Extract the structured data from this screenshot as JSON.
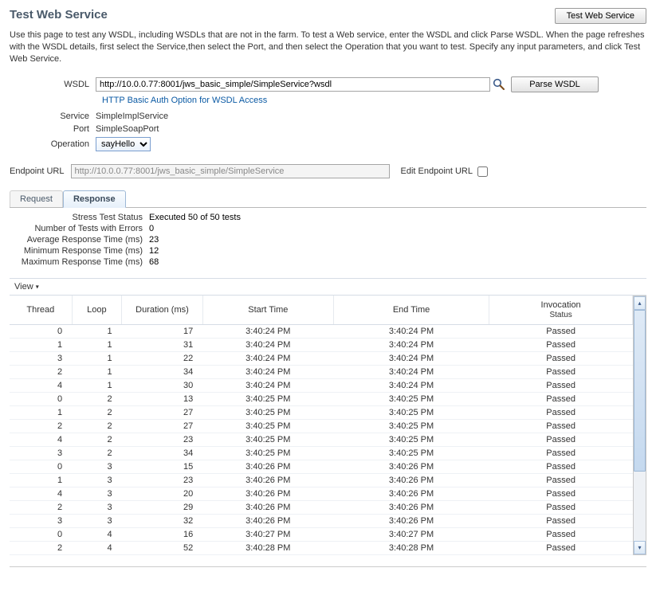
{
  "header": {
    "title": "Test Web Service",
    "top_button": "Test Web Service"
  },
  "intro": "Use this page to test any WSDL, including WSDLs that are not in the farm. To test a Web service, enter the WSDL and click Parse WSDL. When the page refreshes with the WSDL details, first select the Service,then select the Port, and then select the Operation that you want to test. Specify any input parameters, and click Test Web Service.",
  "form": {
    "wsdl_label": "WSDL",
    "wsdl_value": "http://10.0.0.77:8001/jws_basic_simple/SimpleService?wsdl",
    "parse_button": "Parse WSDL",
    "auth_link": "HTTP Basic Auth Option for WSDL Access",
    "service_label": "Service",
    "service_value": "SimpleImplService",
    "port_label": "Port",
    "port_value": "SimpleSoapPort",
    "operation_label": "Operation",
    "operation_value": "sayHello"
  },
  "endpoint": {
    "label": "Endpoint URL",
    "value": "http://10.0.0.77:8001/jws_basic_simple/SimpleService",
    "edit_label": "Edit Endpoint URL"
  },
  "tabs": {
    "request": "Request",
    "response": "Response"
  },
  "summary": {
    "status_label": "Stress Test Status",
    "status_value": "Executed 50 of 50 tests",
    "errors_label": "Number of Tests with Errors",
    "errors_value": "0",
    "avg_label": "Average Response Time (ms)",
    "avg_value": "23",
    "min_label": "Minimum Response Time (ms)",
    "min_value": "12",
    "max_label": "Maximum Response Time (ms)",
    "max_value": "68"
  },
  "view_label": "View",
  "columns": {
    "thread": "Thread",
    "loop": "Loop",
    "duration": "Duration (ms)",
    "start": "Start Time",
    "end": "End Time",
    "status_line1": "Invocation",
    "status_line2": "Status"
  },
  "rows": [
    {
      "thread": "0",
      "loop": "1",
      "dur": "17",
      "start": "3:40:24 PM",
      "end": "3:40:24 PM",
      "status": "Passed"
    },
    {
      "thread": "1",
      "loop": "1",
      "dur": "31",
      "start": "3:40:24 PM",
      "end": "3:40:24 PM",
      "status": "Passed"
    },
    {
      "thread": "3",
      "loop": "1",
      "dur": "22",
      "start": "3:40:24 PM",
      "end": "3:40:24 PM",
      "status": "Passed"
    },
    {
      "thread": "2",
      "loop": "1",
      "dur": "34",
      "start": "3:40:24 PM",
      "end": "3:40:24 PM",
      "status": "Passed"
    },
    {
      "thread": "4",
      "loop": "1",
      "dur": "30",
      "start": "3:40:24 PM",
      "end": "3:40:24 PM",
      "status": "Passed"
    },
    {
      "thread": "0",
      "loop": "2",
      "dur": "13",
      "start": "3:40:25 PM",
      "end": "3:40:25 PM",
      "status": "Passed"
    },
    {
      "thread": "1",
      "loop": "2",
      "dur": "27",
      "start": "3:40:25 PM",
      "end": "3:40:25 PM",
      "status": "Passed"
    },
    {
      "thread": "2",
      "loop": "2",
      "dur": "27",
      "start": "3:40:25 PM",
      "end": "3:40:25 PM",
      "status": "Passed"
    },
    {
      "thread": "4",
      "loop": "2",
      "dur": "23",
      "start": "3:40:25 PM",
      "end": "3:40:25 PM",
      "status": "Passed"
    },
    {
      "thread": "3",
      "loop": "2",
      "dur": "34",
      "start": "3:40:25 PM",
      "end": "3:40:25 PM",
      "status": "Passed"
    },
    {
      "thread": "0",
      "loop": "3",
      "dur": "15",
      "start": "3:40:26 PM",
      "end": "3:40:26 PM",
      "status": "Passed"
    },
    {
      "thread": "1",
      "loop": "3",
      "dur": "23",
      "start": "3:40:26 PM",
      "end": "3:40:26 PM",
      "status": "Passed"
    },
    {
      "thread": "4",
      "loop": "3",
      "dur": "20",
      "start": "3:40:26 PM",
      "end": "3:40:26 PM",
      "status": "Passed"
    },
    {
      "thread": "2",
      "loop": "3",
      "dur": "29",
      "start": "3:40:26 PM",
      "end": "3:40:26 PM",
      "status": "Passed"
    },
    {
      "thread": "3",
      "loop": "3",
      "dur": "32",
      "start": "3:40:26 PM",
      "end": "3:40:26 PM",
      "status": "Passed"
    },
    {
      "thread": "0",
      "loop": "4",
      "dur": "16",
      "start": "3:40:27 PM",
      "end": "3:40:27 PM",
      "status": "Passed"
    },
    {
      "thread": "2",
      "loop": "4",
      "dur": "52",
      "start": "3:40:28 PM",
      "end": "3:40:28 PM",
      "status": "Passed"
    }
  ]
}
